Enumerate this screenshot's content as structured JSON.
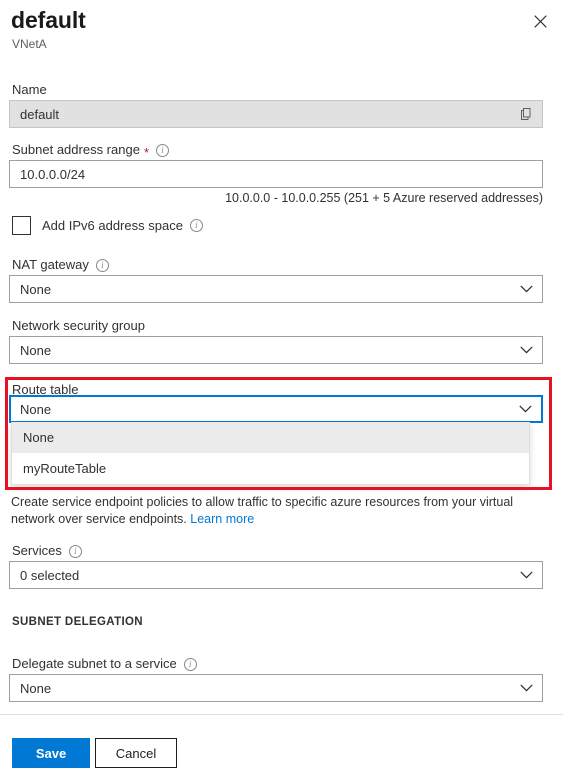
{
  "blade": {
    "title": "default",
    "subtitle": "VNetA",
    "close_icon": "close-icon"
  },
  "form": {
    "name": {
      "label": "Name",
      "value": "default",
      "copy_icon": "copy-icon"
    },
    "subnet_address_range": {
      "label": "Subnet address range",
      "required_marker": "*",
      "info_icon": "info-icon",
      "value": "10.0.0.0/24",
      "helper": "10.0.0.0 - 10.0.0.255 (251 + 5 Azure reserved addresses)"
    },
    "ipv6": {
      "label": "Add IPv6 address space",
      "checked": false
    },
    "nat_gateway": {
      "label": "NAT gateway",
      "value": "None"
    },
    "network_security_group": {
      "label": "Network security group",
      "value": "None"
    },
    "route_table": {
      "label": "Route table",
      "value": "None",
      "expanded": true,
      "options": [
        {
          "label": "None",
          "selected": true
        },
        {
          "label": "myRouteTable",
          "selected": false
        }
      ]
    },
    "service_endpoints": {
      "description": "Create service endpoint policies to allow traffic to specific azure resources from your virtual network over service endpoints.",
      "link_text": "Learn more",
      "services_label": "Services",
      "services_value": "0 selected"
    },
    "subnet_delegation": {
      "section_title": "SUBNET DELEGATION",
      "label": "Delegate subnet to a service",
      "value": "None"
    }
  },
  "footer": {
    "save_label": "Save",
    "cancel_label": "Cancel"
  },
  "colors": {
    "accent": "#0078d4",
    "highlight": "#e81123",
    "link": "#0078d4",
    "required": "#a4262c",
    "option_selected_bg": "#ebebeb"
  }
}
